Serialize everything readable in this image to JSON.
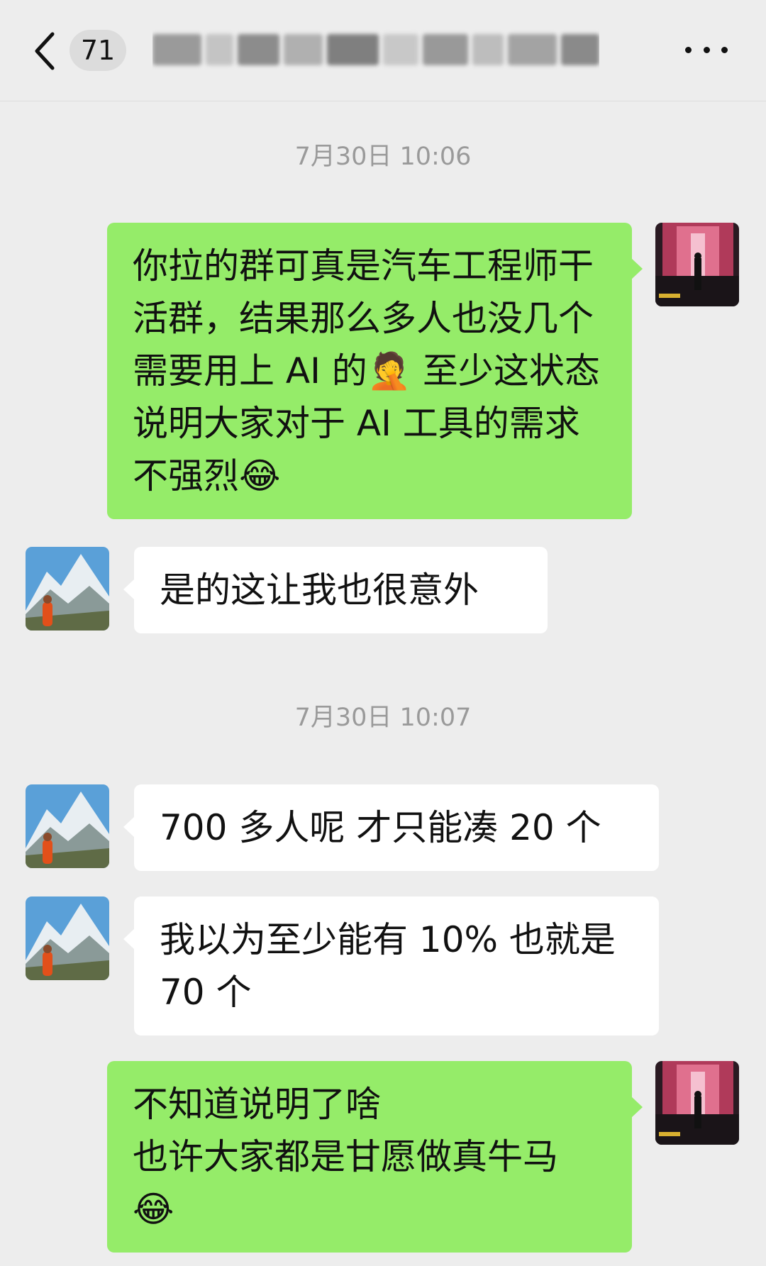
{
  "header": {
    "unread_count": "71",
    "title_blurred": true,
    "back_icon": "chevron-left-icon",
    "more_icon": "more-dots-icon"
  },
  "messages": [
    {
      "type": "time",
      "text": "7月30日 10:06"
    },
    {
      "type": "message",
      "sender": "me",
      "text": "你拉的群可真是汽车工程师干活群，结果那么多人也没几个需要用上 AI 的🤦 至少这状态说明大家对于 AI 工具的需求不强烈😂"
    },
    {
      "type": "message",
      "sender": "other",
      "text": "是的这让我也很意外"
    },
    {
      "type": "time",
      "text": "7月30日 10:07"
    },
    {
      "type": "message",
      "sender": "other",
      "text": "700 多人呢 才只能凑 20 个"
    },
    {
      "type": "message",
      "sender": "other",
      "text": "我以为至少能有 10% 也就是70 个"
    },
    {
      "type": "message",
      "sender": "me",
      "text": "不知道说明了啥\n也许大家都是甘愿做真牛马\n😂"
    }
  ],
  "colors": {
    "background": "#ededed",
    "my_bubble": "#95ec69",
    "other_bubble": "#ffffff",
    "timestamp": "#9a9a9a"
  }
}
